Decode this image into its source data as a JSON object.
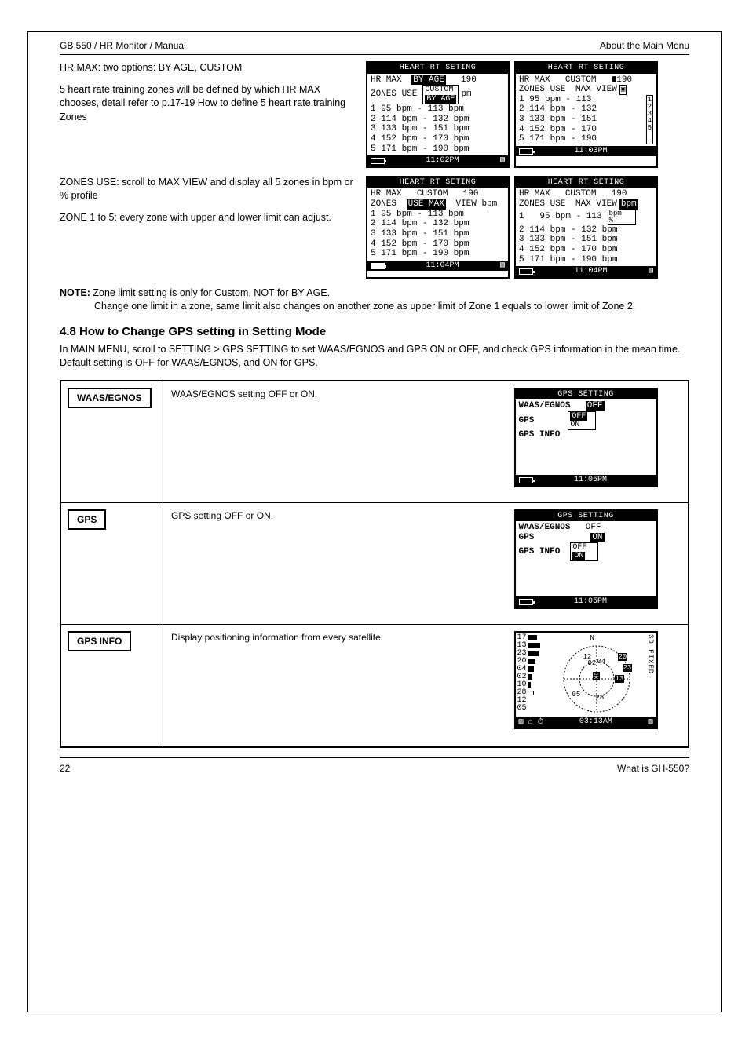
{
  "header": {
    "left": "GB 550 / HR Monitor / Manual",
    "right": "About the Main Menu"
  },
  "intro_text_1": "HR MAX: two options: BY AGE, CUSTOM",
  "intro_text_2": "5 heart rate training zones will be defined by which HR MAX chooses, detail refer to p.17-19 How to define 5 heart rate training Zones",
  "intro_text_3": "ZONES USE: scroll to MAX VIEW and display all 5 zones in bpm or % profile",
  "intro_text_4": "ZONE 1 to 5: every zone with upper and lower limit can adjust.",
  "note_title": "NOTE:",
  "note_1": "Zone limit setting is only for Custom, NOT for BY AGE.",
  "note_2": "Change one limit in a zone, same limit also changes on another zone as upper limit of Zone 1 equals to lower limit of Zone 2.",
  "section_title": "4.8 How to Change GPS setting in Setting Mode",
  "section_para": "In MAIN MENU, scroll to SETTING > GPS SETTING to set WAAS/EGNOS and GPS ON or OFF, and check GPS information in the mean time. Default setting is OFF for WAAS/EGNOS, and ON for GPS.",
  "screens": {
    "hr1": {
      "title": "HEART RT SETING",
      "hrmax_label": "HR MAX",
      "hrmax_mode": "BY AGE",
      "hrmax_val": "190",
      "zones_label": "ZONES USE",
      "zones_dd1": "CUSTOM",
      "zones_dd2": "BY AGE",
      "z1": "1   95 bpm - 113 bpm",
      "z2": "2  114 bpm - 132 bpm",
      "z3": "3  133 bpm - 151 bpm",
      "z4": "4  152 bpm - 170 bpm",
      "z5": "5  171 bpm - 190 bpm",
      "time": "11:02PM"
    },
    "hr2": {
      "title": "HEART RT SETING",
      "hrmax_label": "HR MAX",
      "hrmax_mode": "CUSTOM",
      "hrmax_val": "∎190",
      "zones_label": "ZONES USE",
      "zones_mode": "MAX VIEW",
      "z1l": "1   95 bpm - 113",
      "z1r": "1",
      "z2l": "2  114 bpm - 132",
      "z2r": "2",
      "z3l": "3  133 bpm - 151",
      "z3r": "3",
      "z4l": "4  152 bpm - 170",
      "z4r": "4",
      "z5l": "5  171 bpm - 190",
      "z5r": "5",
      "time": "11:03PM"
    },
    "hr3": {
      "title": "HEART RT SETING",
      "hrmax_label": "HR MAX",
      "hrmax_mode": "CUSTOM",
      "hrmax_val": "190",
      "zones_label": "ZONES",
      "zones_sel": "USE MAX",
      "zones_tail": "VIEW bpm",
      "z1": "1   95 bpm - 113 bpm",
      "z2": "2  114 bpm - 132 bpm",
      "z3": "3  133 bpm - 151 bpm",
      "z4": "4  152 bpm - 170 bpm",
      "z5": "5  171 bpm - 190 bpm",
      "time": "11:04PM"
    },
    "hr4": {
      "title": "HEART RT SETING",
      "hrmax_label": "HR MAX",
      "hrmax_mode": "CUSTOM",
      "hrmax_val": "190",
      "zones_label": "ZONES USE",
      "zones_mode": "MAX VIEW",
      "zones_unit": "bpm",
      "dd1": "bpm",
      "dd2": "%",
      "z1": "1   95 bpm - 113 bpm",
      "z2": "2  114 bpm - 132 bpm",
      "z3": "3  133 bpm - 151 bpm",
      "z4": "4  152 bpm - 170 bpm",
      "z5": "5  171 bpm - 190 bpm",
      "time": "11:04PM"
    }
  },
  "table": {
    "r1": {
      "label": "WAAS/EGNOS",
      "text": "WAAS/EGNOS setting OFF or ON.",
      "screen": {
        "title": "GPS SETTING",
        "l1a": "WAAS/EGNOS",
        "l1b": "OFF",
        "dd1": "OFF",
        "dd2": "ON",
        "l2a": "GPS",
        "l3a": "GPS INFO",
        "time": "11:05PM"
      }
    },
    "r2": {
      "label": "GPS",
      "text": "GPS setting OFF or ON.",
      "screen": {
        "title": "GPS SETTING",
        "l1a": "WAAS/EGNOS",
        "l1b": "OFF",
        "l2a": "GPS",
        "l2b": "ON",
        "dd1": "OFF",
        "dd2": "ON",
        "l3a": "GPS INFO",
        "time": "11:05PM"
      }
    },
    "r3": {
      "label": "GPS INFO",
      "text": "Display positioning information from every satellite.",
      "screen": {
        "sats": [
          "17",
          "13",
          "23",
          "20",
          "04",
          "02",
          "10",
          "28",
          "12",
          "05"
        ],
        "rlabel": "3D FIXED",
        "sky_nums": [
          "12",
          "04",
          "20",
          "02",
          "23",
          "05",
          "28",
          "13"
        ],
        "n": "N",
        "time": "03:13AM"
      }
    }
  },
  "footer": {
    "left": "22",
    "right": "What is GH-550?"
  }
}
